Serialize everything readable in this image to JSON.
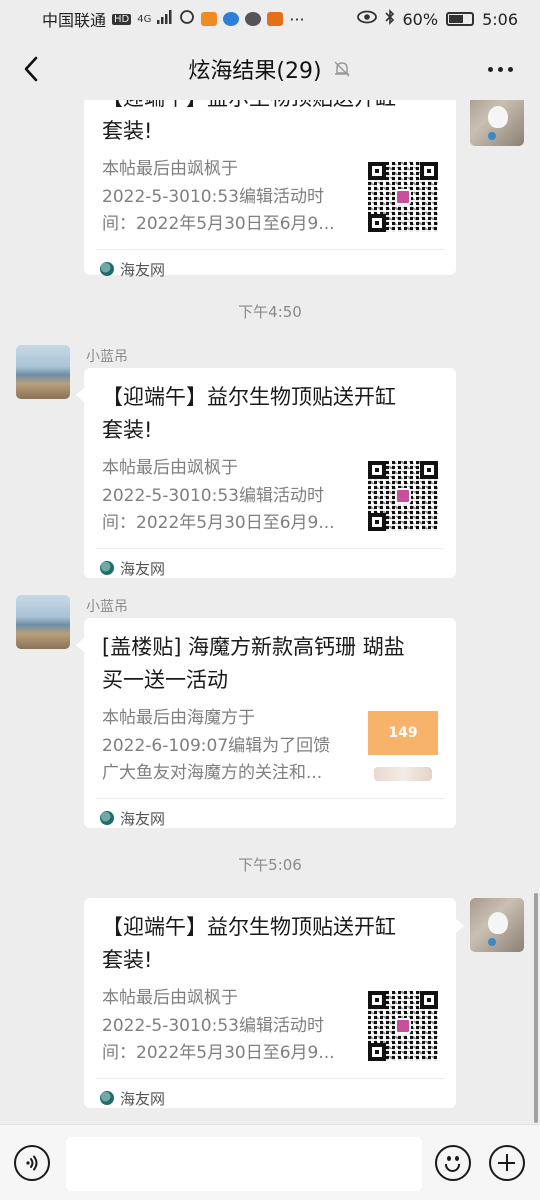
{
  "status_bar": {
    "carrier": "中国联通",
    "network_badge": "HD",
    "signal_label": "4G",
    "battery_percent": "60%",
    "time": "5:06",
    "more_indicator": "···"
  },
  "header": {
    "title": "炫海结果(29)",
    "back_icon": "chevron-left-icon",
    "mute_icon": "bell-off-icon",
    "more_icon": "more-dots-icon"
  },
  "messages": [
    {
      "sender": "",
      "side": "right",
      "title_line2": "套装!",
      "title_line1_partial": "【迎端午】益尔生物顶贴送开缸",
      "desc": [
        "本帖最后由飒枫于",
        "2022-5-3010:53编辑活动时",
        "间：2022年5月30日至6月9..."
      ],
      "source": "海友网",
      "thumb": "qr"
    },
    {
      "time": "下午4:50"
    },
    {
      "sender": "小蓝吊",
      "side": "left",
      "title": [
        "【迎端午】益尔生物顶贴送开缸",
        "套装!"
      ],
      "desc": [
        "本帖最后由飒枫于",
        "2022-5-3010:53编辑活动时",
        "间：2022年5月30日至6月9..."
      ],
      "source": "海友网",
      "thumb": "qr"
    },
    {
      "sender": "小蓝吊",
      "side": "left",
      "title": [
        "[盖楼贴] 海魔方新款高钙珊 瑚盐",
        "买一送一活动"
      ],
      "desc": [
        "本帖最后由海魔方于",
        "2022-6-109:07编辑为了回馈",
        "广大鱼友对海魔方的关注和..."
      ],
      "source": "海友网",
      "thumb": "promo",
      "thumb_text": "149"
    },
    {
      "time": "下午5:06"
    },
    {
      "sender": "",
      "side": "right",
      "title": [
        "【迎端午】益尔生物顶贴送开缸",
        "套装!"
      ],
      "desc": [
        "本帖最后由飒枫于",
        "2022-5-3010:53编辑活动时",
        "间：2022年5月30日至6月9..."
      ],
      "source": "海友网",
      "thumb": "qr"
    }
  ],
  "input_bar": {
    "voice_icon": "voice-icon",
    "emoji_icon": "emoji-icon",
    "plus_icon": "plus-icon",
    "placeholder": ""
  }
}
